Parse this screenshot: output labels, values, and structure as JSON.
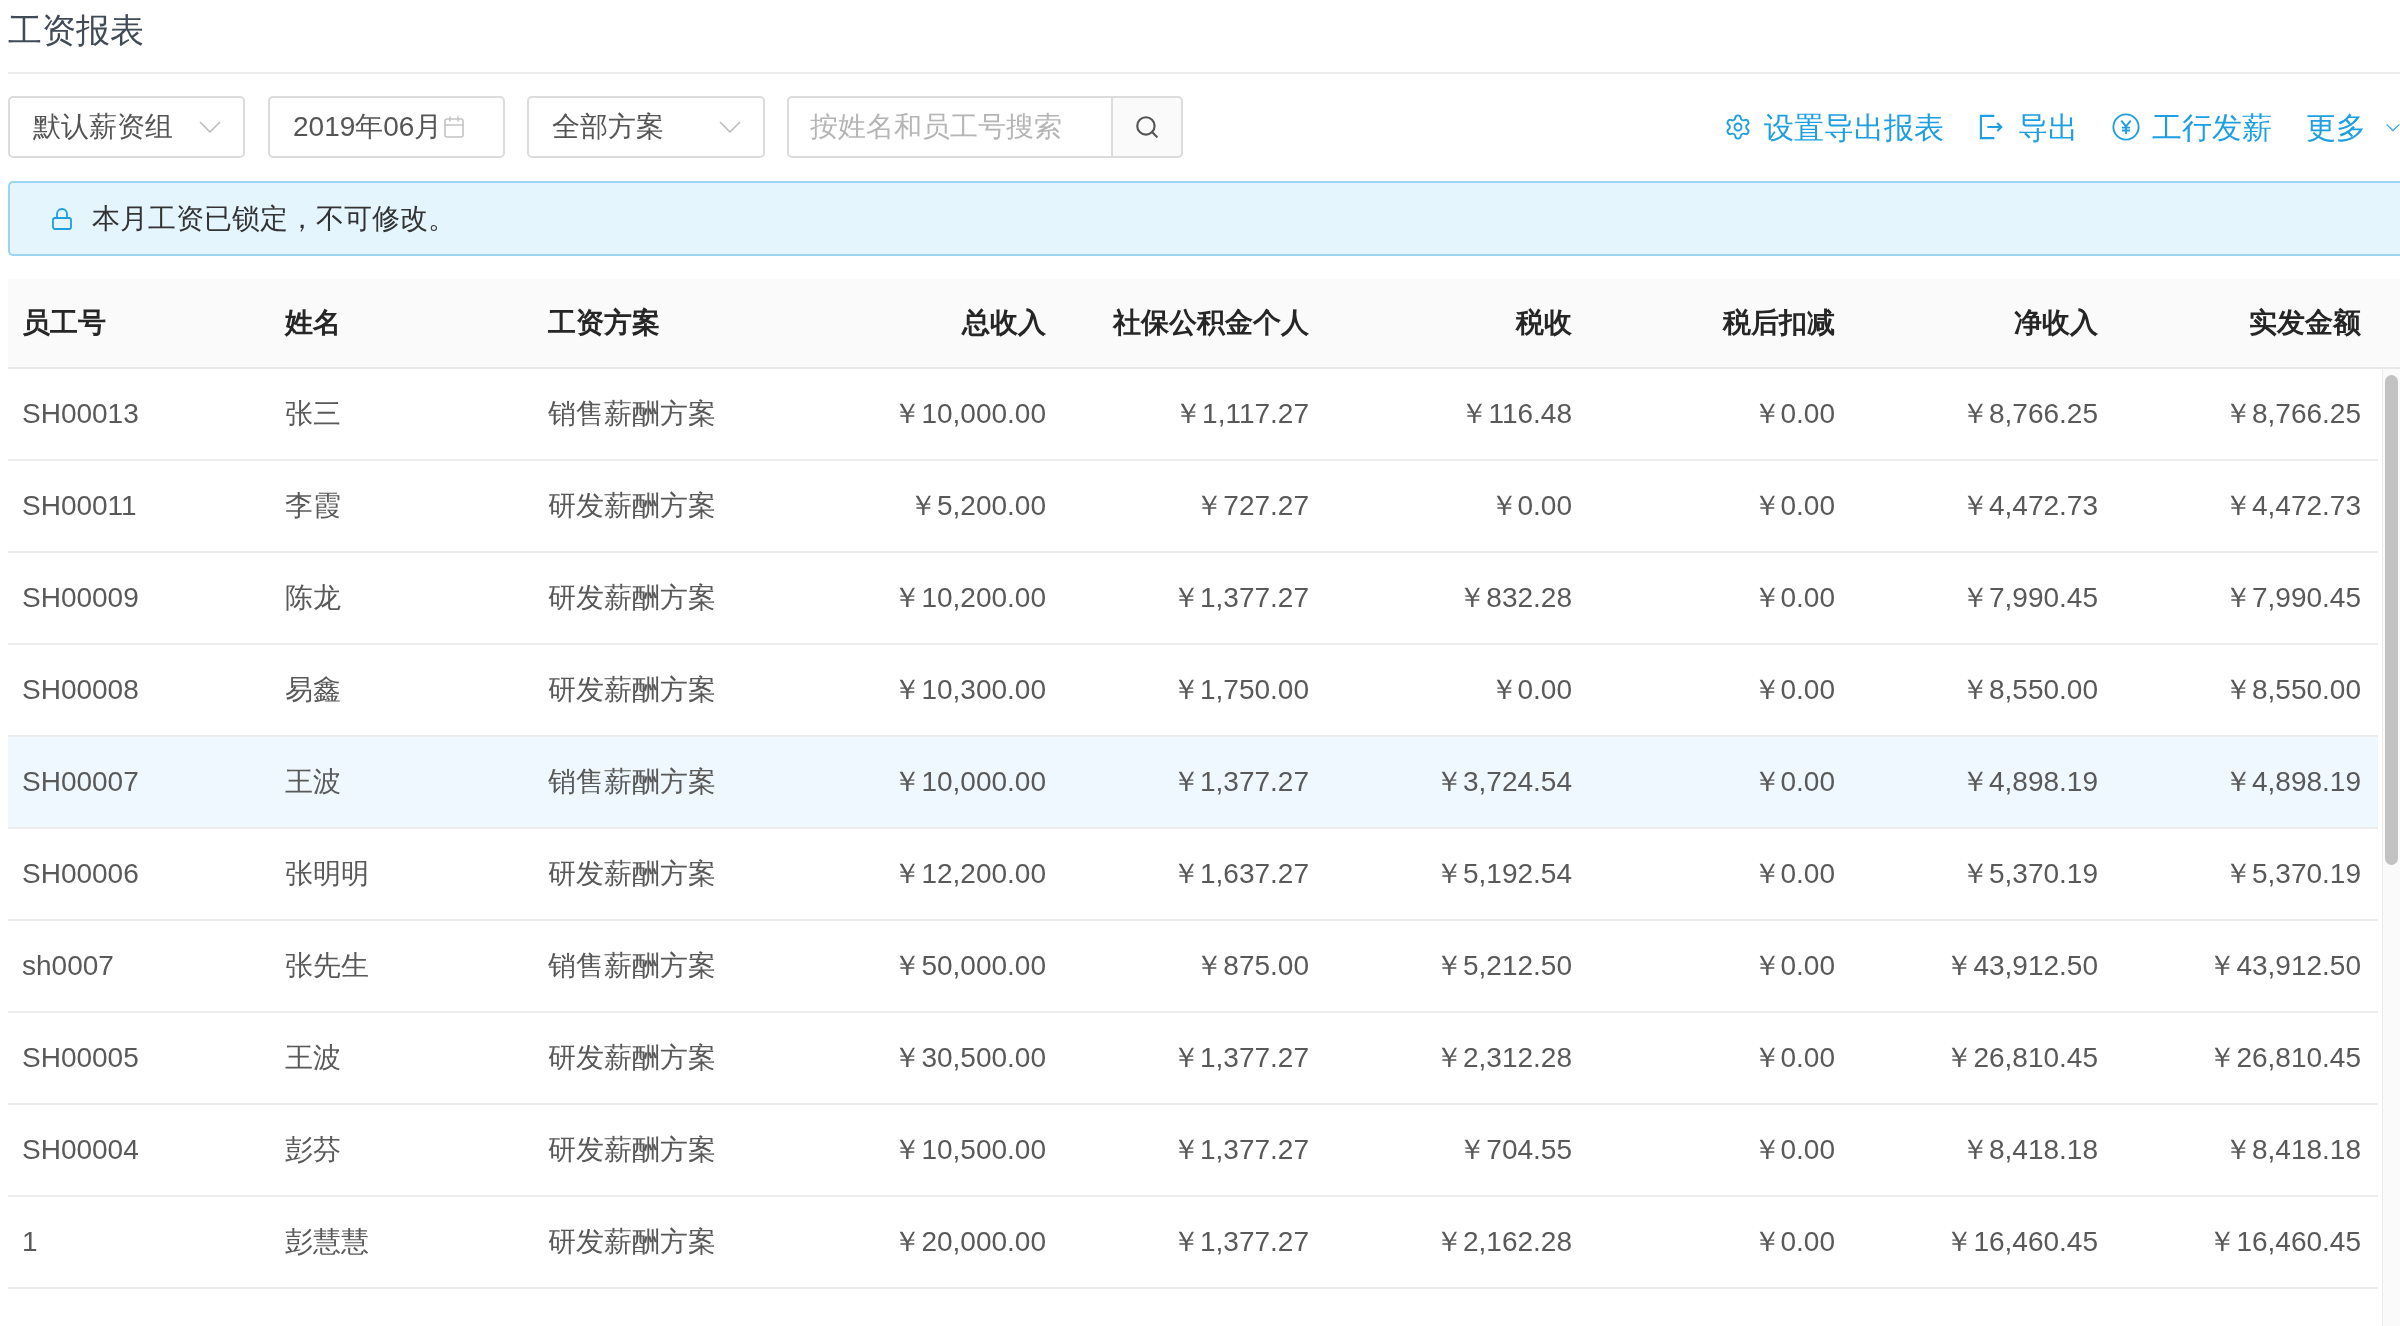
{
  "page": {
    "title": "工资报表"
  },
  "toolbar": {
    "salary_group": {
      "value": "默认薪资组"
    },
    "month": {
      "value": "2019年06月"
    },
    "plan": {
      "value": "全部方案"
    },
    "search": {
      "placeholder": "按姓名和员工号搜索"
    },
    "actions": [
      {
        "kind": "settings",
        "label": "设置导出报表"
      },
      {
        "kind": "export",
        "label": "导出"
      },
      {
        "kind": "payroll",
        "label": "工行发薪"
      },
      {
        "kind": "more",
        "label": "更多"
      }
    ]
  },
  "alert": {
    "text": "本月工资已锁定，不可修改。"
  },
  "table": {
    "columns": [
      {
        "label": "员工号",
        "kind": "text"
      },
      {
        "label": "姓名",
        "kind": "text"
      },
      {
        "label": "工资方案",
        "kind": "text"
      },
      {
        "label": "总收入",
        "kind": "amount"
      },
      {
        "label": "社保公积金个人",
        "kind": "amount"
      },
      {
        "label": "税收",
        "kind": "amount"
      },
      {
        "label": "税后扣减",
        "kind": "amount"
      },
      {
        "label": "净收入",
        "kind": "amount"
      },
      {
        "label": "实发金额",
        "kind": "amount"
      }
    ],
    "rows": [
      {
        "highlighted": false,
        "cells": [
          "SH00013",
          "张三",
          "销售薪酬方案",
          "￥10,000.00",
          "￥1,117.27",
          "￥116.48",
          "￥0.00",
          "￥8,766.25",
          "￥8,766.25"
        ]
      },
      {
        "highlighted": false,
        "cells": [
          "SH00011",
          "李霞",
          "研发薪酬方案",
          "￥5,200.00",
          "￥727.27",
          "￥0.00",
          "￥0.00",
          "￥4,472.73",
          "￥4,472.73"
        ]
      },
      {
        "highlighted": false,
        "cells": [
          "SH00009",
          "陈龙",
          "研发薪酬方案",
          "￥10,200.00",
          "￥1,377.27",
          "￥832.28",
          "￥0.00",
          "￥7,990.45",
          "￥7,990.45"
        ]
      },
      {
        "highlighted": false,
        "cells": [
          "SH00008",
          "易鑫",
          "研发薪酬方案",
          "￥10,300.00",
          "￥1,750.00",
          "￥0.00",
          "￥0.00",
          "￥8,550.00",
          "￥8,550.00"
        ]
      },
      {
        "highlighted": true,
        "cells": [
          "SH00007",
          "王波",
          "销售薪酬方案",
          "￥10,000.00",
          "￥1,377.27",
          "￥3,724.54",
          "￥0.00",
          "￥4,898.19",
          "￥4,898.19"
        ]
      },
      {
        "highlighted": false,
        "cells": [
          "SH00006",
          "张明明",
          "研发薪酬方案",
          "￥12,200.00",
          "￥1,637.27",
          "￥5,192.54",
          "￥0.00",
          "￥5,370.19",
          "￥5,370.19"
        ]
      },
      {
        "highlighted": false,
        "cells": [
          "sh0007",
          "张先生",
          "销售薪酬方案",
          "￥50,000.00",
          "￥875.00",
          "￥5,212.50",
          "￥0.00",
          "￥43,912.50",
          "￥43,912.50"
        ]
      },
      {
        "highlighted": false,
        "cells": [
          "SH00005",
          "王波",
          "研发薪酬方案",
          "￥30,500.00",
          "￥1,377.27",
          "￥2,312.28",
          "￥0.00",
          "￥26,810.45",
          "￥26,810.45"
        ]
      },
      {
        "highlighted": false,
        "cells": [
          "SH00004",
          "彭芬",
          "研发薪酬方案",
          "￥10,500.00",
          "￥1,377.27",
          "￥704.55",
          "￥0.00",
          "￥8,418.18",
          "￥8,418.18"
        ]
      },
      {
        "highlighted": false,
        "cells": [
          "1",
          "彭慧慧",
          "研发薪酬方案",
          "￥20,000.00",
          "￥1,377.27",
          "￥2,162.28",
          "￥0.00",
          "￥16,460.45",
          "￥16,460.45"
        ]
      }
    ]
  }
}
